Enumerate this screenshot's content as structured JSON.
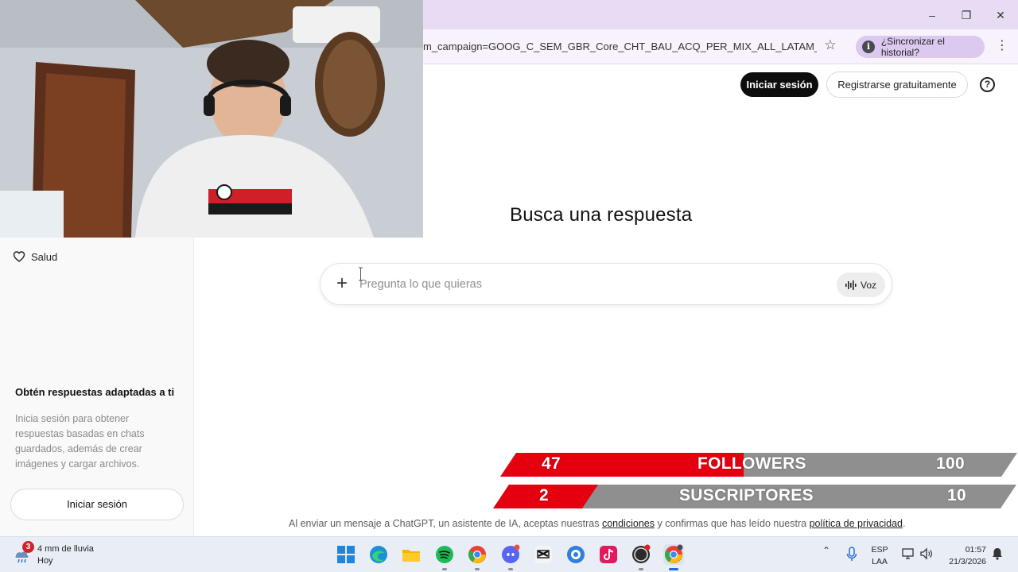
{
  "browser": {
    "url": "m_campaign=GOOG_C_SEM_GBR_Core_CHT_BAU_ACQ_PER_MIX_ALL_LATAM_AR_E...",
    "sync_label": "¿Sincronizar el historial?",
    "window_controls": [
      "minimize-icon",
      "restore-icon",
      "close-icon"
    ]
  },
  "header": {
    "login_label": "Iniciar sesión",
    "register_label": "Registrarse gratuitamente",
    "help_label": "?"
  },
  "sidebar": {
    "health_label": "Salud",
    "promo_title": "Obtén respuestas adaptadas a ti",
    "promo_text": "Inicia sesión para obtener respuestas basadas en chats guardados, además de crear imágenes y cargar archivos.",
    "login_label": "Iniciar sesión"
  },
  "main": {
    "headline": "Busca una respuesta",
    "composer_placeholder": "Pregunta lo que quieras",
    "voice_label": "Voz",
    "footer_prefix": "Al enviar un mensaje a ChatGPT, un asistente de IA, aceptas nuestras ",
    "footer_terms": "condiciones",
    "footer_middle": " y confirmas que has leído nuestra ",
    "footer_privacy": "política de privacidad",
    "footer_suffix": "."
  },
  "overlay": {
    "followers": {
      "current": "47",
      "label": "FOLLOWERS",
      "goal": "100",
      "progress": 0.47
    },
    "subscribers": {
      "current": "2",
      "label": "SUSCRIPTORES",
      "goal": "10",
      "progress": 0.2
    }
  },
  "taskbar": {
    "weather_badge": "3",
    "weather_line1": "4 mm de lluvia",
    "weather_line2": "Hoy",
    "apps": [
      "windows-start-icon",
      "edge-icon",
      "file-explorer-icon",
      "spotify-icon",
      "chrome-icon",
      "discord-icon",
      "capcut-icon",
      "app-icon",
      "tiktok-icon",
      "obs-icon",
      "chrome-active-icon"
    ],
    "lang_line1": "ESP",
    "lang_line2": "LAA",
    "time": "01:57",
    "date": "21/3/2026"
  },
  "colors": {
    "accent_red": "#e4000f",
    "bar_grey": "#8f8f8f",
    "titlebar": "#e8dcf5"
  }
}
